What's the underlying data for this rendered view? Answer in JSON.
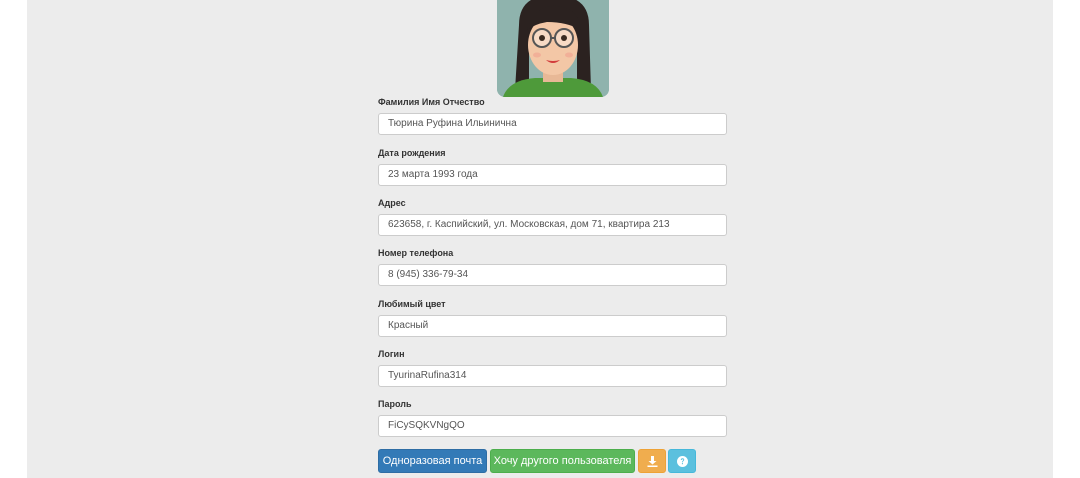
{
  "profile": {
    "fields": [
      {
        "label": "Фамилия Имя Отчество",
        "value": "Тюрина Руфина Ильинична"
      },
      {
        "label": "Дата рождения",
        "value": "23 марта 1993 года"
      },
      {
        "label": "Адрес",
        "value": "623658, г. Каспийский, ул. Московская, дом 71, квартира 213"
      },
      {
        "label": "Номер телефона",
        "value": "8 (945) 336-79-34"
      },
      {
        "label": "Любимый цвет",
        "value": "Красный"
      },
      {
        "label": "Логин",
        "value": "TyurinaRufina314"
      },
      {
        "label": "Пароль",
        "value": "FiCySQKVNgQO"
      }
    ]
  },
  "actions": {
    "temp_mail_label": "Одноразовая почта",
    "another_user_label": "Хочу другого пользователя",
    "download_icon": "download-icon",
    "help_icon": "question-circle-icon"
  },
  "colors": {
    "primary": "#337ab7",
    "success": "#5cb85c",
    "warning": "#f0ad4e",
    "info": "#5bc0de",
    "background": "#ececec"
  }
}
